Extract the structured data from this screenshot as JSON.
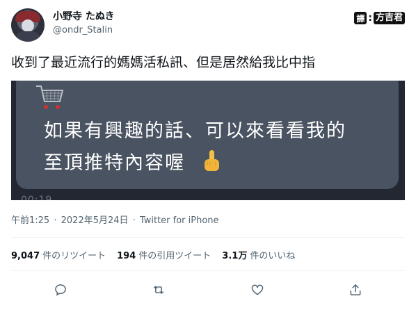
{
  "user": {
    "display_name": "小野寺 たぬき",
    "handle": "@ondr_Stalin"
  },
  "watermark": {
    "symbol": "譯",
    "colon": ":",
    "name": "方吉君"
  },
  "tweet": {
    "text": "收到了最近流行的媽媽活私訊、但是居然給我比中指"
  },
  "media": {
    "message_line_1": "如果有興趣的話、可以來看看我的",
    "message_line_2": "至頂推特內容喔",
    "timestamp_partial": "00:19",
    "icons": [
      "cart-icon",
      "middle-finger-emoji"
    ]
  },
  "meta": {
    "time": "午前1:25",
    "separator": "·",
    "date": "2022年5月24日",
    "source": "Twitter for iPhone"
  },
  "stats": [
    {
      "num": "9,047",
      "label": "件のリツイート"
    },
    {
      "num": "194",
      "label": "件の引用ツイート"
    },
    {
      "num": "3.1万",
      "label": "件のいいね"
    }
  ],
  "actions": [
    "reply-icon",
    "retweet-icon",
    "like-icon",
    "share-icon"
  ],
  "colors": {
    "text": "#0f1419",
    "secondary": "#536471",
    "bubble": "#4a5361",
    "media_bg": "#232731"
  }
}
